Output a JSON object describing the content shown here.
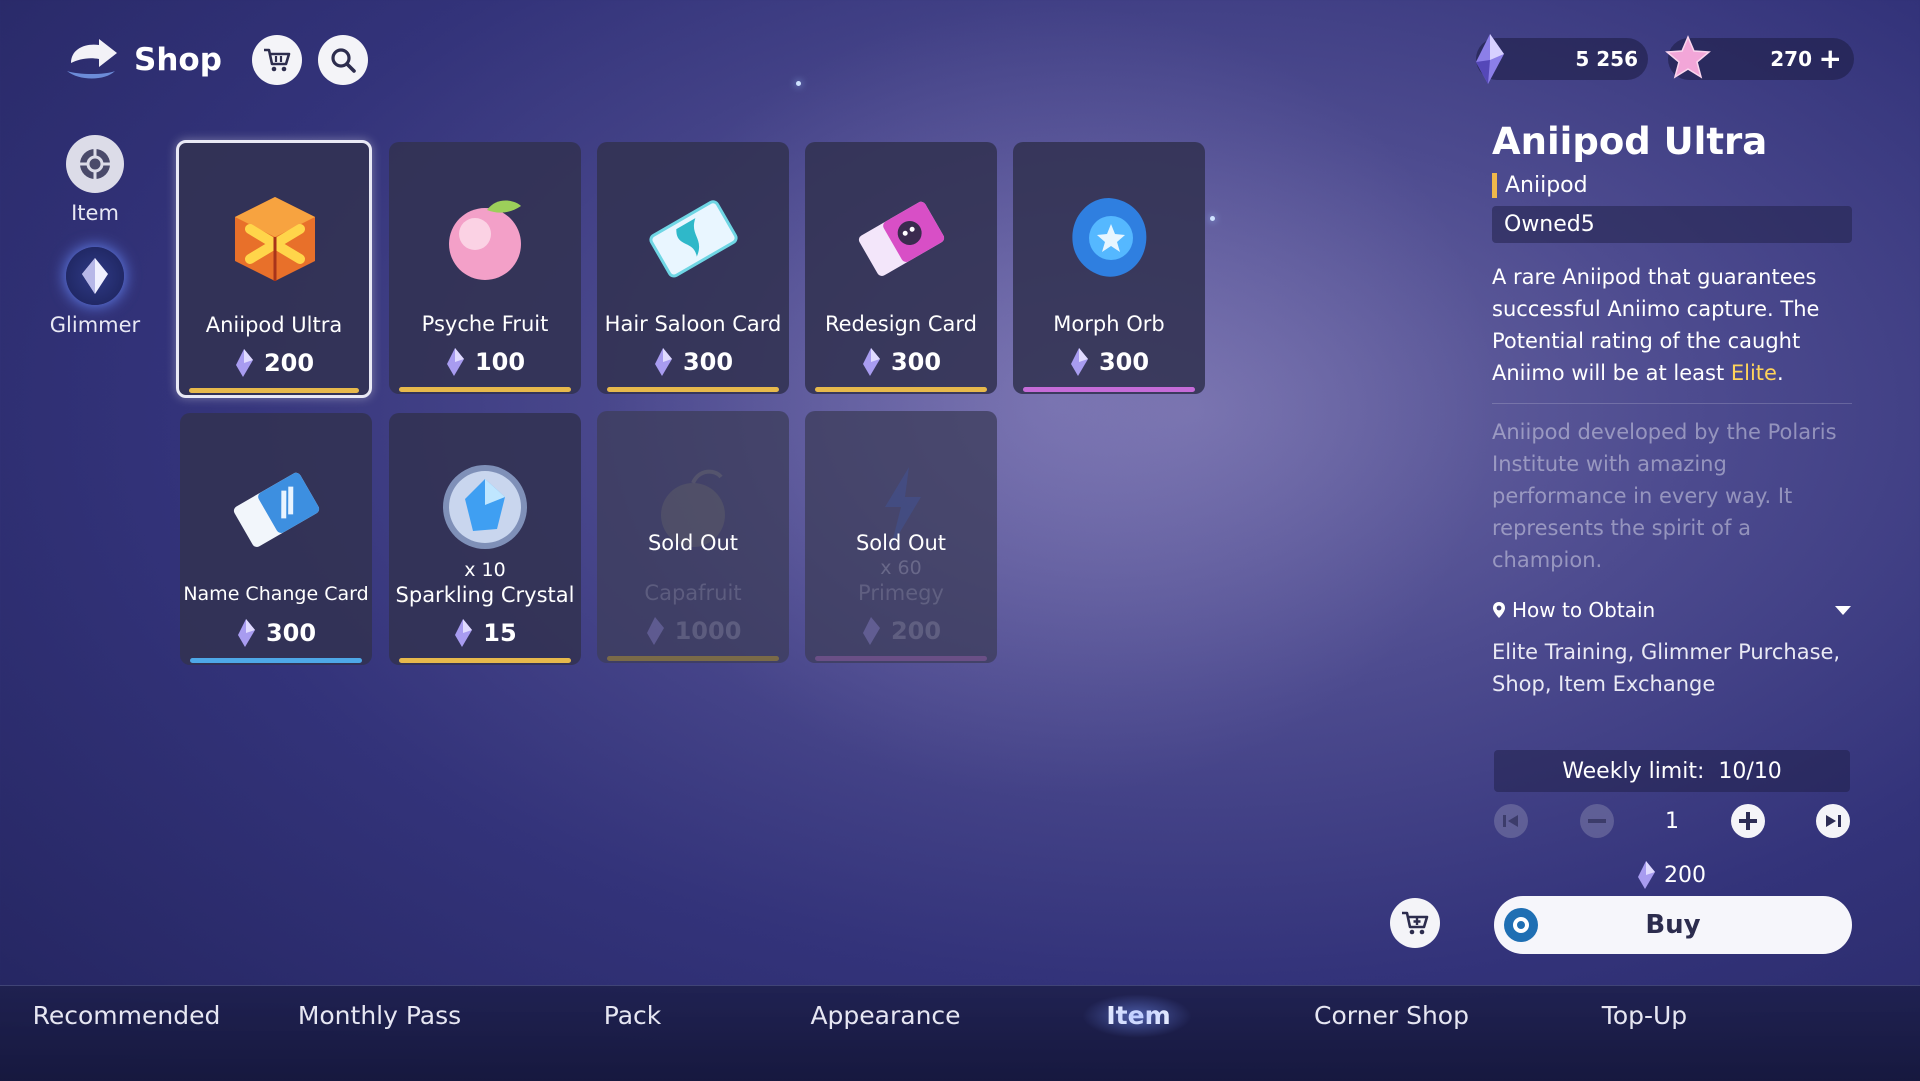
{
  "header": {
    "title": "Shop"
  },
  "currencies": {
    "glimmer": "5 256",
    "star": "270",
    "add": "+"
  },
  "side_nav": [
    {
      "label": "Item",
      "icon": "item-icon"
    },
    {
      "label": "Glimmer",
      "icon": "glimmer-icon"
    }
  ],
  "items": [
    {
      "name": "Aniipod Ultra",
      "price": "200",
      "bar_color": "#e7b94c",
      "selected": true,
      "icon": "aniipod-ultra-icon"
    },
    {
      "name": "Psyche Fruit",
      "price": "100",
      "bar_color": "#e7b94c",
      "icon": "psyche-fruit-icon"
    },
    {
      "name": "Hair Saloon Card",
      "price": "300",
      "bar_color": "#e7b94c",
      "icon": "hair-saloon-card-icon"
    },
    {
      "name": "Redesign Card",
      "price": "300",
      "bar_color": "#e7b94c",
      "icon": "redesign-card-icon"
    },
    {
      "name": "Morph Orb",
      "price": "300",
      "bar_color": "#c56bd8",
      "icon": "morph-orb-icon"
    },
    {
      "name": "Name Change Card",
      "price": "300",
      "bar_color": "#4ea8e8",
      "icon": "name-change-card-icon"
    },
    {
      "name": "Sparkling Crystal",
      "price": "15",
      "qty": "x 10",
      "bar_color": "#e7b94c",
      "icon": "sparkling-crystal-icon"
    },
    {
      "name": "Capafruit",
      "price": "1000",
      "sold_out": "Sold Out",
      "bar_color": "#7a6a48",
      "icon": "capafruit-icon"
    },
    {
      "name": "Primegy",
      "price": "200",
      "qty": "x 60",
      "sold_out": "Sold Out",
      "bar_color": "#6a4f86",
      "icon": "primegy-icon"
    }
  ],
  "detail": {
    "title": "Aniipod Ultra",
    "category": "Aniipod",
    "owned": "Owned5",
    "desc_before": "A rare Aniipod that guarantees successful Aniimo capture. The Potential rating of the caught Aniimo will be at least ",
    "desc_elite": "Elite",
    "desc_after": ".",
    "lore": "Aniipod developed by the Polaris Institute with amazing performance in every way. It represents the spirit of a champion.",
    "how_to_obtain": "How to Obtain",
    "sources": "Elite Training, Glimmer Purchase, Shop, Item Exchange",
    "weekly_limit_label": "Weekly limit:",
    "weekly_limit_value": "10/10",
    "quantity": "1",
    "total": "200",
    "buy_label": "Buy"
  },
  "tabs": [
    {
      "label": "Recommended"
    },
    {
      "label": "Monthly Pass"
    },
    {
      "label": "Pack"
    },
    {
      "label": "Appearance"
    },
    {
      "label": "Item",
      "active": true
    },
    {
      "label": "Corner Shop"
    },
    {
      "label": "Top-Up"
    }
  ]
}
